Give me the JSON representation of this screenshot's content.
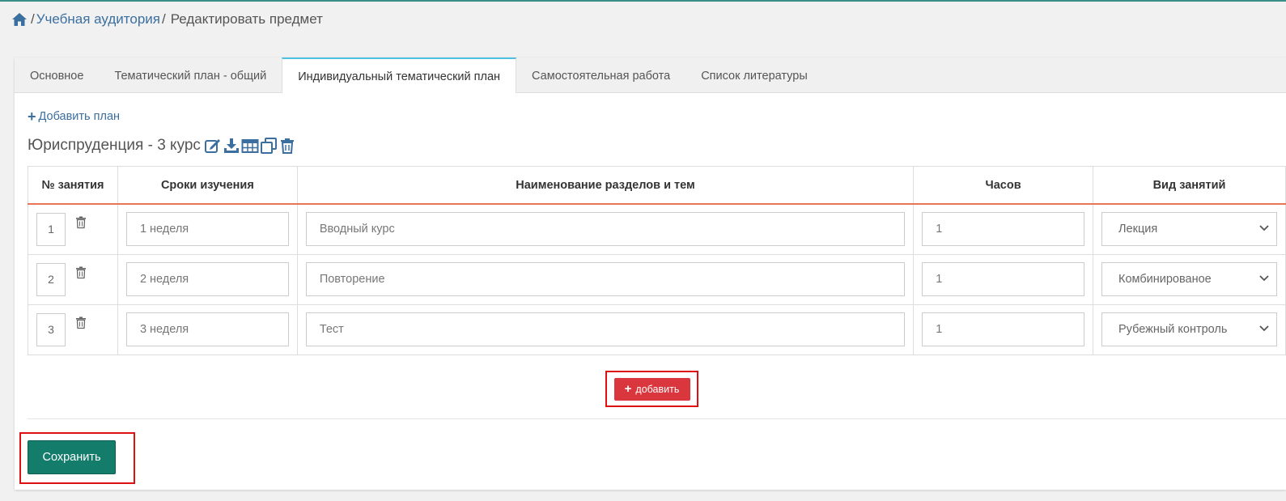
{
  "breadcrumb": {
    "home_icon": "home-icon",
    "link": "Учебная аудитория",
    "current": "Редактировать предмет"
  },
  "tabs": [
    {
      "label": "Основное",
      "active": false
    },
    {
      "label": "Тематический план - общий",
      "active": false
    },
    {
      "label": "Индивидуальный тематический план",
      "active": true
    },
    {
      "label": "Самостоятельная работа",
      "active": false
    },
    {
      "label": "Список литературы",
      "active": false
    }
  ],
  "add_plan_label": "Добавить план",
  "plan_title": "Юриспруденция - 3 курс",
  "plan_icons": [
    "edit-icon",
    "download-icon",
    "table-icon",
    "copy-icon",
    "trash-icon"
  ],
  "table": {
    "headers": [
      "№ занятия",
      "Сроки изучения",
      "Наименование разделов и тем",
      "Часов",
      "Вид занятий"
    ],
    "rows": [
      {
        "num": "1",
        "period": "1 неделя",
        "topic": "Вводный курс",
        "hours": "1",
        "type": "Лекция"
      },
      {
        "num": "2",
        "period": "2 неделя",
        "topic": "Повторение",
        "hours": "1",
        "type": "Комбинированое"
      },
      {
        "num": "3",
        "period": "3 неделя",
        "topic": "Тест",
        "hours": "1",
        "type": "Рубежный контроль"
      }
    ]
  },
  "add_row_label": "добавить",
  "save_label": "Сохранить",
  "colors": {
    "accent_link": "#3b6fa0",
    "add_button": "#d9363e",
    "save_button": "#137c6a",
    "highlight_border": "#d11111",
    "header_underline": "#e8745a",
    "active_tab_top": "#4ec0e3"
  }
}
